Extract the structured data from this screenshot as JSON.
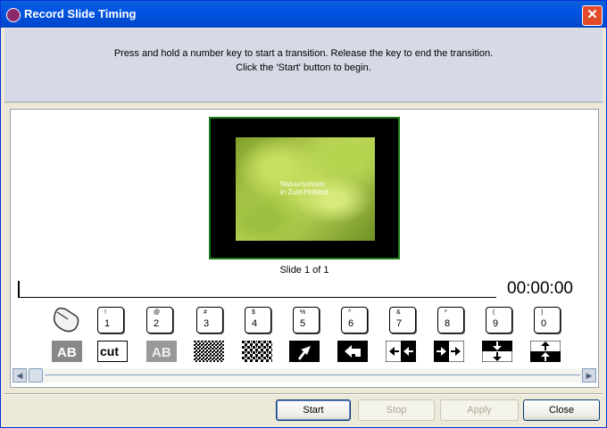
{
  "window": {
    "title": "Record Slide Timing",
    "close_glyph": "✕"
  },
  "instructions": {
    "line1": "Press and hold a number key to start a transition.  Release the key to end the transition.",
    "line2": "Click the 'Start' button to begin."
  },
  "slide": {
    "caption_line1": "Natuurschoon",
    "caption_line2": "in Zuid-Holland",
    "counter": "Slide 1 of 1"
  },
  "timer": "00:00:00",
  "keys": [
    {
      "top": "!",
      "main": "1"
    },
    {
      "top": "@",
      "main": "2"
    },
    {
      "top": "#",
      "main": "3"
    },
    {
      "top": "$",
      "main": "4"
    },
    {
      "top": "%",
      "main": "5"
    },
    {
      "top": "^",
      "main": "6"
    },
    {
      "top": "&",
      "main": "7"
    },
    {
      "top": "*",
      "main": "8"
    },
    {
      "top": "(",
      "main": "9"
    },
    {
      "top": ")",
      "main": "0"
    }
  ],
  "transitions": [
    {
      "icon": "fade-ab-icon",
      "text": "AB"
    },
    {
      "icon": "cut-icon",
      "text": "cut"
    },
    {
      "icon": "crossfade-ab-icon",
      "text": "AB"
    },
    {
      "icon": "dissolve-icon"
    },
    {
      "icon": "pixelate-icon"
    },
    {
      "icon": "arrow-up-right-icon"
    },
    {
      "icon": "arrow-left-curve-icon"
    },
    {
      "icon": "wipe-left-icon"
    },
    {
      "icon": "wipe-right-icon"
    },
    {
      "icon": "wipe-down-icon"
    },
    {
      "icon": "wipe-up-icon"
    }
  ],
  "buttons": {
    "start": "Start",
    "stop": "Stop",
    "apply": "Apply",
    "close": "Close"
  },
  "scrollbar": {
    "left_glyph": "◀",
    "right_glyph": "▶"
  },
  "colors": {
    "title_bar": "#0054e3",
    "slide_border": "#1a7a1a",
    "instruction_bg": "#d6dae6"
  }
}
